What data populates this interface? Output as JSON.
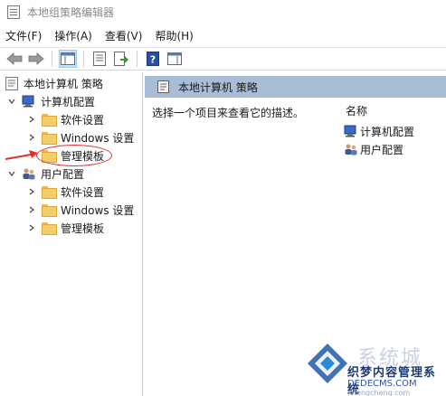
{
  "window": {
    "title": "本地组策略编辑器"
  },
  "menu": [
    {
      "label": "文件(F)"
    },
    {
      "label": "操作(A)"
    },
    {
      "label": "查看(V)"
    },
    {
      "label": "帮助(H)"
    }
  ],
  "toolbar": {
    "buttons": [
      "back-icon",
      "forward-icon",
      "show-tree-icon",
      "properties-icon",
      "export-list-icon",
      "help-icon",
      "show-pane-icon"
    ]
  },
  "tree": {
    "root": "本地计算机 策略",
    "computer_config": "计算机配置",
    "user_config": "用户配置",
    "computer_children": [
      "软件设置",
      "Windows 设置",
      "管理模板"
    ],
    "user_children": [
      "软件设置",
      "Windows 设置",
      "管理模板"
    ]
  },
  "right": {
    "header": "本地计算机 策略",
    "description": "选择一个项目来查看它的描述。",
    "column_name": "名称",
    "items": [
      "计算机配置",
      "用户配置"
    ]
  },
  "annotation": {
    "color": "#e03030"
  },
  "watermark": {
    "brand": "系统城",
    "line1": "织梦内容管理系统",
    "line2": "DEDECMS.COM",
    "line3": "xitongcheng.com"
  },
  "colors": {
    "header_bg": "#a8bdd6",
    "selection": "#cce4f7",
    "folder": "#f3cf6a"
  }
}
